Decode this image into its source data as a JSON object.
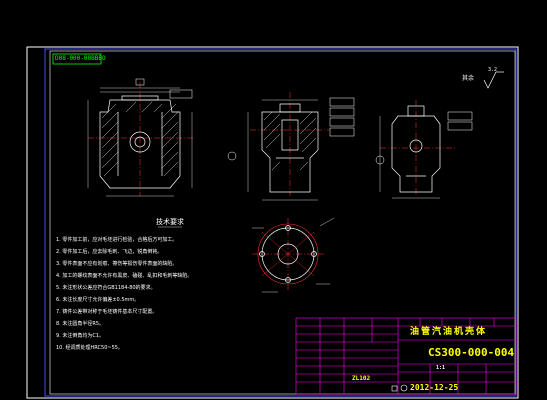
{
  "drawing": {
    "header_code": "D08-000-00BBBO",
    "section_title": "技术要求",
    "roughness_label": "其余",
    "roughness_value": "3.2",
    "requirements": [
      "1. 零件加工前，应对毛坯进行检验，合格后方可加工。",
      "2. 零件加工后，应去除毛刺、飞边，锐角倒钝。",
      "3. 零件表面不应有划痕、擦伤等损伤零件表面的缺陷。",
      "4. 加工的螺纹表面不允许有黑皮、磕碰、乱扣和毛刺等缺陷。",
      "5. 未注形状公差应符合GB1184-80的要求。",
      "6. 未注长度尺寸允许偏差±0.5mm。",
      "7. 铸件公差带对称于毛坯铸件基本尺寸配置。",
      "8. 未注圆角半径R5。",
      "9. 未注倒角均为C1。",
      "10. 经调质处理HRC50~55。"
    ]
  },
  "title_block": {
    "part_name": "油管汽油机壳体",
    "drawing_number": "CS300-000-004",
    "material": "ZL102",
    "date": "2012-12-25",
    "scale": "1:1"
  },
  "colors": {
    "background": "#000000",
    "border": "#ffffff",
    "border_inner": "#4a4aff",
    "geometry": "#ffffff",
    "centerline": "#ff3030",
    "dimension": "#ffffff",
    "hatch": "#ffffff",
    "title_accent": "#ffff00",
    "title_frame": "#ff00ff",
    "code_frame": "#00ff00",
    "text_dim": "#c0c0c0"
  }
}
